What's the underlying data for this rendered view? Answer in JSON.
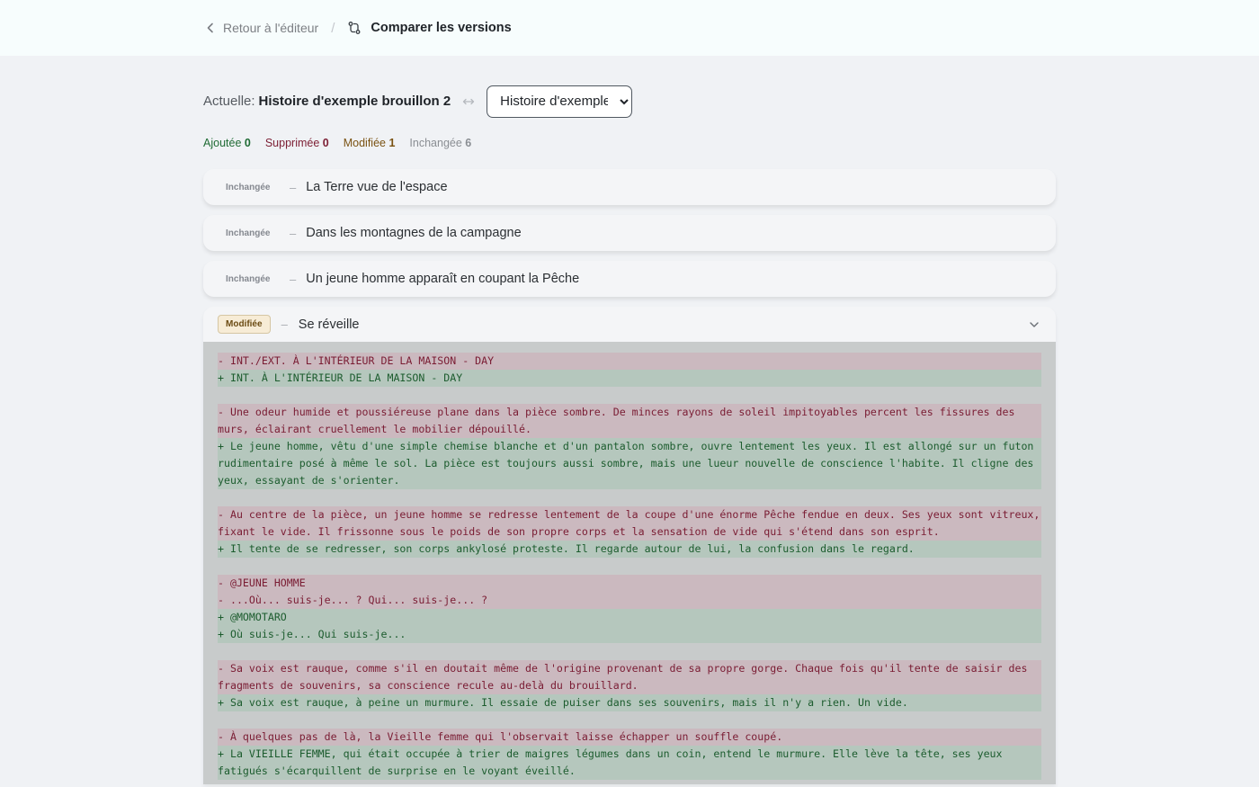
{
  "header": {
    "back_label": "Retour à l'éditeur",
    "separator": "/",
    "title": "Comparer les versions"
  },
  "versions": {
    "current_label": "Actuelle:",
    "current_name": "Histoire d'exemple brouillon 2",
    "compare_selected": "Histoire d'exemple"
  },
  "stats": {
    "added_label": "Ajoutée",
    "added_count": "0",
    "removed_label": "Supprimée",
    "removed_count": "0",
    "modified_label": "Modifiée",
    "modified_count": "1",
    "unchanged_label": "Inchangée",
    "unchanged_count": "6"
  },
  "scenes": [
    {
      "status": "Inchangée",
      "dash": "–",
      "title": "La Terre vue de l'espace"
    },
    {
      "status": "Inchangée",
      "dash": "–",
      "title": "Dans les montagnes de la campagne"
    },
    {
      "status": "Inchangée",
      "dash": "–",
      "title": "Un jeune homme apparaît en coupant la Pêche"
    }
  ],
  "modified_scene": {
    "status": "Modifiée",
    "dash": "–",
    "title": "Se réveille",
    "diff": [
      [
        {
          "type": "del",
          "text": "- INT./EXT. À L'INTÉRIEUR DE LA MAISON - DAY"
        },
        {
          "type": "add",
          "text": "+ INT. À L'INTÉRIEUR DE LA MAISON - DAY"
        }
      ],
      [
        {
          "type": "del",
          "text": "- Une odeur humide et poussiéreuse plane dans la pièce sombre. De minces rayons de soleil impitoyables percent les fissures des murs, éclairant cruellement le mobilier dépouillé."
        },
        {
          "type": "add",
          "text": "+ Le jeune homme, vêtu d'une simple chemise blanche et d'un pantalon sombre, ouvre lentement les yeux. Il est allongé sur un futon rudimentaire posé à même le sol. La pièce est toujours aussi sombre, mais une lueur nouvelle de conscience l'habite. Il cligne des yeux, essayant de s'orienter."
        }
      ],
      [
        {
          "type": "del",
          "text": "- Au centre de la pièce, un jeune homme se redresse lentement de la coupe d'une énorme Pêche fendue en deux. Ses yeux sont vitreux, fixant le vide. Il frissonne sous le poids de son propre corps et la sensation de vide qui s'étend dans son esprit."
        },
        {
          "type": "add",
          "text": "+ Il tente de se redresser, son corps ankylosé proteste. Il regarde autour de lui, la confusion dans le regard."
        }
      ],
      [
        {
          "type": "del",
          "text": "- @JEUNE HOMME"
        },
        {
          "type": "del",
          "text": "- ...Où... suis-je... ? Qui... suis-je... ?"
        },
        {
          "type": "add",
          "text": "+ @MOMOTARO"
        },
        {
          "type": "add",
          "text": "+ Où suis-je... Qui suis-je..."
        }
      ],
      [
        {
          "type": "del",
          "text": "- Sa voix est rauque, comme s'il en doutait même de l'origine provenant de sa propre gorge. Chaque fois qu'il tente de saisir des fragments de souvenirs, sa conscience recule au-delà du brouillard."
        },
        {
          "type": "add",
          "text": "+ Sa voix est rauque, à peine un murmure. Il essaie de puiser dans ses souvenirs, mais il n'y a rien. Un vide."
        }
      ],
      [
        {
          "type": "del",
          "text": "- À quelques pas de là, la Vieille femme qui l'observait laisse échapper un souffle coupé."
        },
        {
          "type": "add",
          "text": "+ La VIEILLE FEMME, qui était occupée à trier de maigres légumes dans un coin, entend le murmure. Elle lève la tête, ses yeux fatigués s'écarquillent de surprise en le voyant éveillé."
        }
      ]
    ]
  }
}
